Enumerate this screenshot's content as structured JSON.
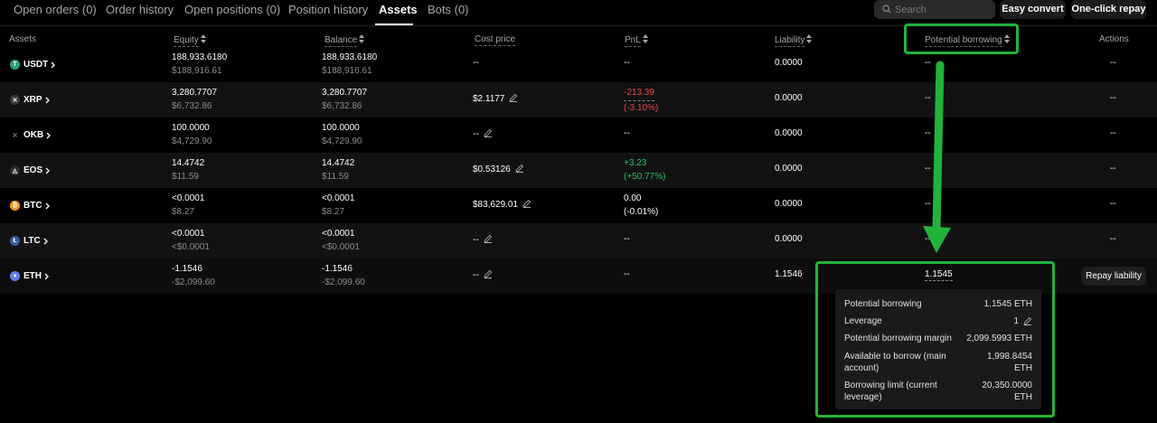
{
  "tabs": [
    {
      "label": "Open orders (0)"
    },
    {
      "label": "Order history"
    },
    {
      "label": "Open positions (0)"
    },
    {
      "label": "Position history"
    },
    {
      "label": "Assets"
    },
    {
      "label": "Bots (0)"
    }
  ],
  "active_tab": "Assets",
  "search": {
    "placeholder": "Search",
    "icon": "search-icon"
  },
  "toolbar": {
    "easy_convert": "Easy convert",
    "one_click_repay": "One-click repay"
  },
  "columns": {
    "assets": "Assets",
    "equity": "Equity",
    "balance": "Balance",
    "cost_price": "Cost price",
    "pnl": "PnL",
    "liability": "Liability",
    "potential_borrowing": "Potential borrowing",
    "actions": "Actions"
  },
  "rows": [
    {
      "asset": "USDT",
      "coin_color": "#26a17b",
      "equity": "188,933.6180",
      "equity_usd": "$188,916.61",
      "balance": "188,933.6180",
      "balance_usd": "$188,916.61",
      "cost": "--",
      "pnl": "--",
      "pnl_pct": "",
      "liability": "0.0000",
      "potential": "--",
      "action": "--"
    },
    {
      "asset": "XRP",
      "coin_color": "#3a3a3a",
      "equity": "3,280.7707",
      "equity_usd": "$6,732.86",
      "balance": "3,280.7707",
      "balance_usd": "$6,732.86",
      "cost": "$2.1177",
      "pnl": "-213.39",
      "pnl_pct": "(-3.10%)",
      "liability": "0.0000",
      "potential": "--",
      "action": "--"
    },
    {
      "asset": "OKB",
      "coin_color": "#000000",
      "equity": "100.0000",
      "equity_usd": "$4,729.90",
      "balance": "100.0000",
      "balance_usd": "$4,729.90",
      "cost": "--",
      "pnl": "--",
      "pnl_pct": "",
      "liability": "0.0000",
      "potential": "--",
      "action": "--"
    },
    {
      "asset": "EOS",
      "coin_color": "#2b2b2b",
      "equity": "14.4742",
      "equity_usd": "$11.59",
      "balance": "14.4742",
      "balance_usd": "$11.59",
      "cost": "$0.53126",
      "pnl": "+3.23",
      "pnl_pct": "(+50.77%)",
      "liability": "0.0000",
      "potential": "--",
      "action": "--"
    },
    {
      "asset": "BTC",
      "coin_color": "#f7931a",
      "equity": "<0.0001",
      "equity_usd": "$8.27",
      "balance": "<0.0001",
      "balance_usd": "$8.27",
      "cost": "$83,629.01",
      "pnl": "0.00",
      "pnl_pct": "(-0.01%)",
      "liability": "0.0000",
      "potential": "--",
      "action": "--"
    },
    {
      "asset": "LTC",
      "coin_color": "#345d9d",
      "equity": "<0.0001",
      "equity_usd": "<$0.0001",
      "balance": "<0.0001",
      "balance_usd": "<$0.0001",
      "cost": "--",
      "pnl": "--",
      "pnl_pct": "",
      "liability": "0.0000",
      "potential": "--",
      "action": "--"
    },
    {
      "asset": "ETH",
      "coin_color": "#627eea",
      "equity": "-1.1546",
      "equity_usd": "-$2,099.60",
      "balance": "-1.1546",
      "balance_usd": "-$2,099.60",
      "cost": "--",
      "pnl": "--",
      "pnl_pct": "",
      "liability": "1.1546",
      "potential": "1.1545",
      "action": "Repay liability"
    }
  ],
  "tooltip": {
    "potential_borrowing": {
      "label": "Potential borrowing",
      "value": "1.1545 ETH"
    },
    "leverage": {
      "label": "Leverage",
      "value": "1"
    },
    "margin": {
      "label": "Potential borrowing margin",
      "value": "2,099.5993 ETH"
    },
    "available": {
      "label": "Available to borrow (main account)",
      "value": "1,998.8454 ETH"
    },
    "limit": {
      "label": "Borrowing limit (current leverage)",
      "value": "20,350.0000 ETH"
    }
  },
  "colors": {
    "highlight": "#22b33a",
    "positive": "#25c26e",
    "negative": "#e5484d"
  }
}
